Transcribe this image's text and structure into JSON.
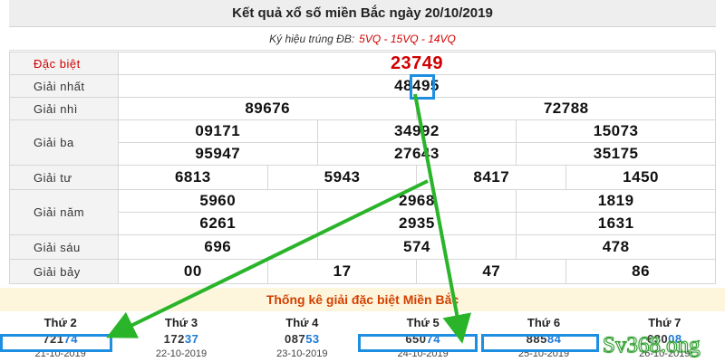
{
  "title": "Kết quả xổ số miền Bắc ngày 20/10/2019",
  "subtitle": {
    "label": "Ký hiệu trúng ĐB:",
    "codes": "5VQ - 15VQ - 14VQ"
  },
  "prizes": {
    "special": {
      "label": "Đặc biệt",
      "numbers": [
        "23749"
      ]
    },
    "first": {
      "label": "Giải nhất",
      "numbers": [
        "48495"
      ]
    },
    "second": {
      "label": "Giải nhì",
      "numbers": [
        "89676",
        "72788"
      ]
    },
    "third": {
      "label": "Giải ba",
      "numbers": [
        "09171",
        "34992",
        "15073",
        "95947",
        "27643",
        "35175"
      ]
    },
    "fourth": {
      "label": "Giải tư",
      "numbers": [
        "6813",
        "5943",
        "8417",
        "1450"
      ]
    },
    "fifth": {
      "label": "Giải năm",
      "numbers": [
        "5960",
        "2968",
        "1819",
        "6261",
        "2935",
        "1631"
      ]
    },
    "sixth": {
      "label": "Giải sáu",
      "numbers": [
        "696",
        "574",
        "478"
      ]
    },
    "seventh": {
      "label": "Giải bảy",
      "numbers": [
        "00",
        "17",
        "47",
        "86"
      ]
    }
  },
  "stats": {
    "title": "Thống kê giải đặc biệt Miền Bắc",
    "days": [
      {
        "name": "Thứ 2",
        "prefix": "721",
        "suffix": "74",
        "date": "21-10-2019"
      },
      {
        "name": "Thứ 3",
        "prefix": "172",
        "suffix": "37",
        "date": "22-10-2019"
      },
      {
        "name": "Thứ 4",
        "prefix": "087",
        "suffix": "53",
        "date": "23-10-2019"
      },
      {
        "name": "Thứ 5",
        "prefix": "650",
        "suffix": "74",
        "date": "24-10-2019"
      },
      {
        "name": "Thứ 6",
        "prefix": "885",
        "suffix": "84",
        "date": "25-10-2019"
      },
      {
        "name": "Thứ 7",
        "prefix": "630",
        "suffix": "08",
        "date": "26-10-2019"
      }
    ]
  },
  "watermark": "Sv368.ong",
  "colors": {
    "special_red": "#d10000",
    "highlight_blue": "#1e8fe0",
    "arrow_green": "#2ab42a",
    "stats_title": "#d34000"
  }
}
